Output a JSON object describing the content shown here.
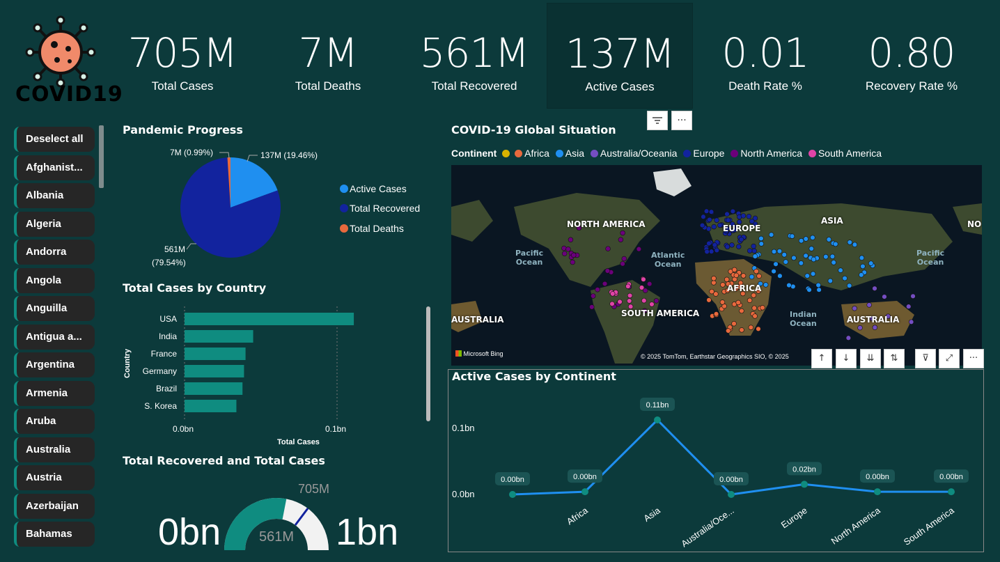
{
  "logo": {
    "text": "COVID19"
  },
  "kpis": [
    {
      "value": "705M",
      "label": "Total Cases"
    },
    {
      "value": "7M",
      "label": "Total Deaths"
    },
    {
      "value": "561M",
      "label": "Total Recovered"
    },
    {
      "value": "137M",
      "label": "Active Cases"
    },
    {
      "value": "0.01",
      "label": "Death Rate %"
    },
    {
      "value": "0.80",
      "label": "Recovery Rate %"
    }
  ],
  "visual_header": {
    "filter_icon": "filter-icon",
    "more_icon": "more-options-icon",
    "more_label": "···"
  },
  "slicer": {
    "items": [
      "Deselect all",
      "Afghanist...",
      "Albania",
      "Algeria",
      "Andorra",
      "Angola",
      "Anguilla",
      "Antigua a...",
      "Argentina",
      "Armenia",
      "Aruba",
      "Australia",
      "Austria",
      "Azerbaijan",
      "Bahamas"
    ]
  },
  "pandemic_progress": {
    "title": "Pandemic Progress",
    "labels": {
      "deaths": "7M (0.99%)",
      "active": "137M (19.46%)",
      "recovered_1": "561M",
      "recovered_2": "(79.54%)"
    },
    "legend": [
      "Active Cases",
      "Total Recovered",
      "Total Deaths"
    ],
    "colors": {
      "active": "#1f8ff0",
      "recovered": "#12239e",
      "deaths": "#e8693d"
    }
  },
  "cases_by_country": {
    "title": "Total Cases by Country",
    "ylabel": "Country",
    "xlabel": "Total Cases",
    "ticks": [
      "0.0bn",
      "0.1bn"
    ]
  },
  "recovered_vs_total": {
    "title": "Total Recovered and Total Cases",
    "min_label": "0bn",
    "max_label": "1bn",
    "value_label": "561M",
    "target_label": "705M"
  },
  "map": {
    "title": "COVID-19 Global Situation",
    "legend_title": "Continent",
    "legend": [
      {
        "name": "Africa",
        "color": "#e8693d"
      },
      {
        "name": "Asia",
        "color": "#1f8ff0"
      },
      {
        "name": "Australia/Oceania",
        "color": "#744ec2"
      },
      {
        "name": "Europe",
        "color": "#12239e"
      },
      {
        "name": "North America",
        "color": "#6b007b"
      },
      {
        "name": "South America",
        "color": "#e044a7"
      }
    ],
    "legend_first_color": "#d9b300",
    "continent_labels": [
      "NORTH AMERICA",
      "EUROPE",
      "ASIA",
      "NO",
      "AFRICA",
      "SOUTH AMERICA",
      "AUSTRALIA",
      "AUSTRALIA"
    ],
    "ocean_labels": [
      "Pacific\nOcean",
      "Atlantic\nOcean",
      "Indian\nOcean",
      "Pacific\nOcean"
    ],
    "attribution": "© 2025 TomTom, Earthstar Geographics SIO, © 2025",
    "bing_label": "Microsoft Bing"
  },
  "map_toolbar": [
    "↑",
    "↓",
    "⇊",
    "⇅",
    "⊽",
    "⤢",
    "···"
  ],
  "active_by_continent": {
    "title": "Active Cases by Continent",
    "y_ticks": [
      "0.1bn",
      "0.0bn"
    ]
  },
  "chart_data": [
    {
      "type": "pie",
      "title": "Pandemic Progress",
      "categories": [
        "Active Cases",
        "Total Recovered",
        "Total Deaths"
      ],
      "values": [
        137,
        561,
        7
      ],
      "unit": "M",
      "percentages": [
        19.46,
        79.54,
        0.99
      ]
    },
    {
      "type": "bar",
      "orientation": "horizontal",
      "title": "Total Cases by Country",
      "categories": [
        "USA",
        "India",
        "France",
        "Germany",
        "Brazil",
        "S. Korea"
      ],
      "values": [
        0.111,
        0.045,
        0.04,
        0.039,
        0.038,
        0.034
      ],
      "xlabel": "Total Cases",
      "ylabel": "Country",
      "xlim": [
        0,
        0.12
      ],
      "unit": "bn",
      "color": "#0f8c80"
    },
    {
      "type": "line",
      "title": "Active Cases by Continent",
      "categories": [
        "Africa",
        "Asia",
        "Australia/Oce...",
        "Europe",
        "North America",
        "South America"
      ],
      "x_leading_point": true,
      "values": [
        0.0,
        0.004,
        0.11,
        0.0,
        0.015,
        0.004,
        0.004
      ],
      "data_labels": [
        "0.00bn",
        "0.00bn",
        "0.11bn",
        "0.00bn",
        "0.02bn",
        "0.00bn",
        "0.00bn"
      ],
      "ylim": [
        0,
        0.12
      ],
      "unit": "bn",
      "color": "#1f8ff0"
    }
  ]
}
